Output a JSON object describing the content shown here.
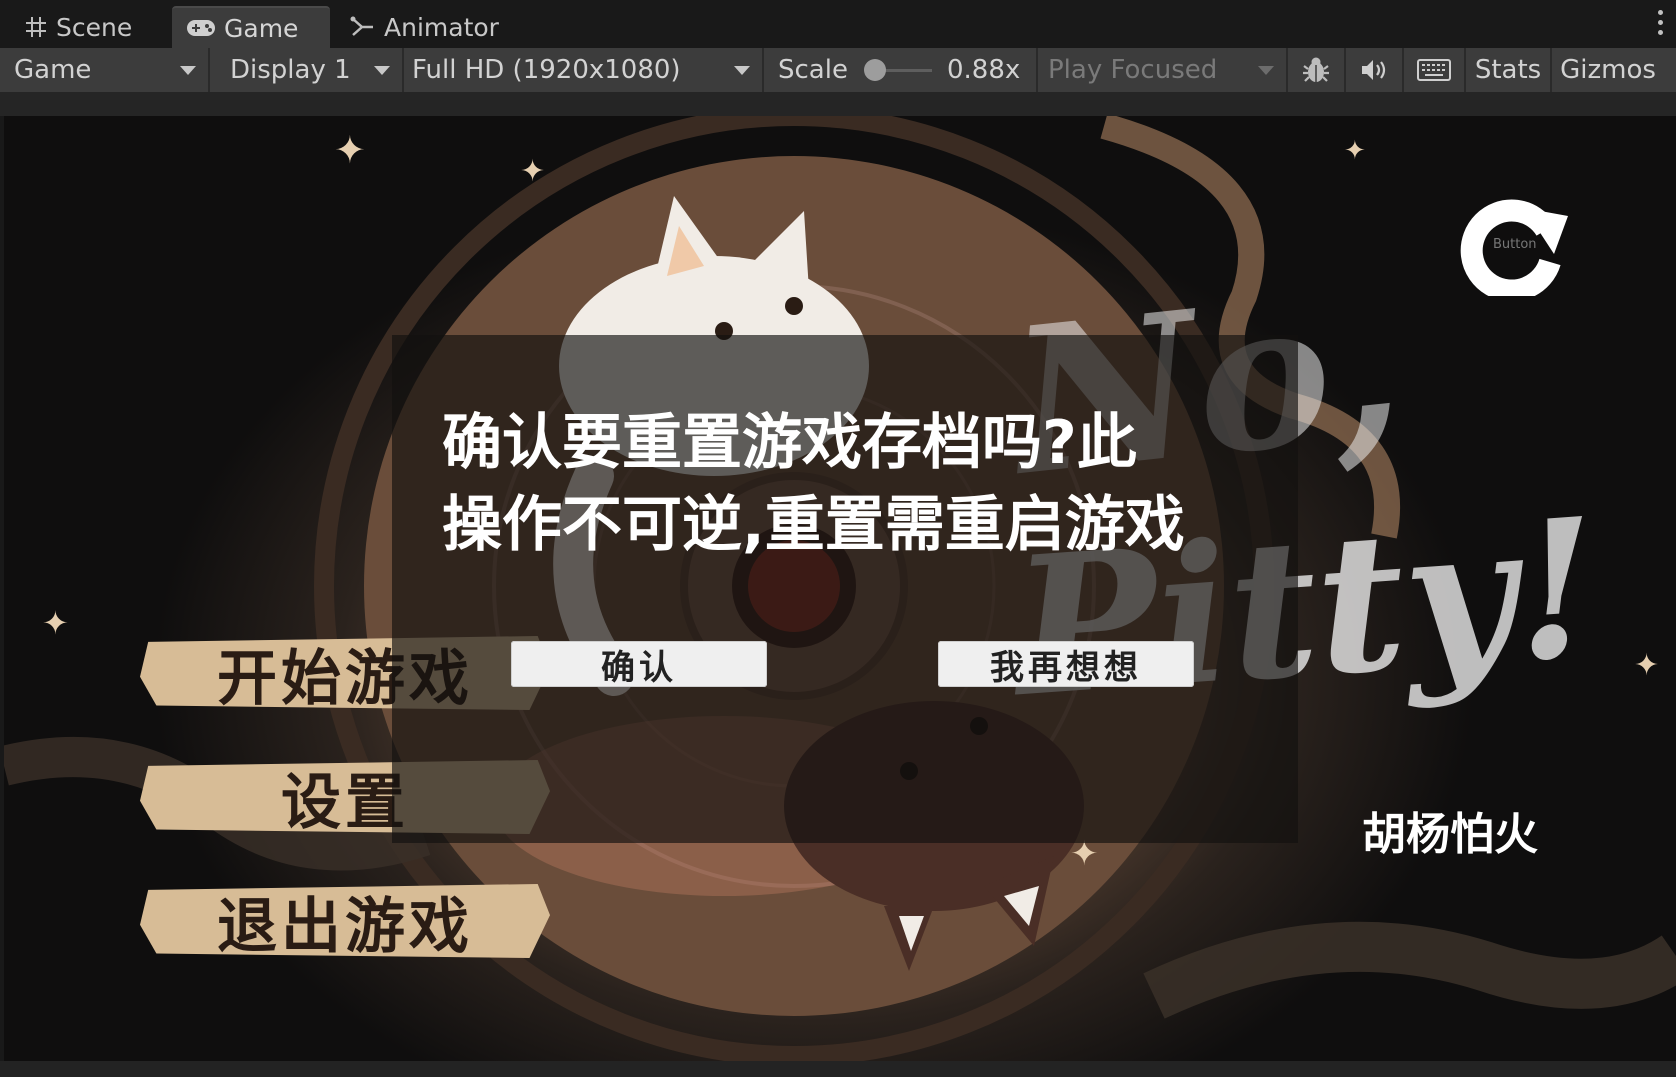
{
  "tabs": [
    {
      "label": "Scene",
      "icon": "grid-icon"
    },
    {
      "label": "Game",
      "icon": "gamepad-icon",
      "active": true
    },
    {
      "label": "Animator",
      "icon": "animator-icon"
    }
  ],
  "toolbar": {
    "view_select": "Game",
    "display_select": "Display 1",
    "resolution_select": "Full HD (1920x1080)",
    "scale_label": "Scale",
    "scale_value": "0.88x",
    "play_mode_select": "Play Focused",
    "stats_label": "Stats",
    "gizmos_label": "Gizmos",
    "icons": [
      "bug-icon",
      "speaker-icon",
      "keyboard-icon"
    ]
  },
  "game": {
    "menu": {
      "start": "开始游戏",
      "settings": "设置",
      "quit": "退出游戏"
    },
    "dialog": {
      "message_line1": "确认要重置游戏存档吗?此",
      "message_line2": "操作不可逆,重置需重启游戏",
      "confirm": "确认",
      "reconsider": "我再想想"
    },
    "title_art": "No, Pitty!",
    "title_parts": {
      "top": "No,",
      "bottom": "Pitty!"
    },
    "author": "胡杨怕火",
    "reset_button_label": "Button",
    "colors": {
      "banner": "#d7bc96",
      "dialog_bg": "#12100f",
      "dialog_button": "#efefef"
    }
  }
}
